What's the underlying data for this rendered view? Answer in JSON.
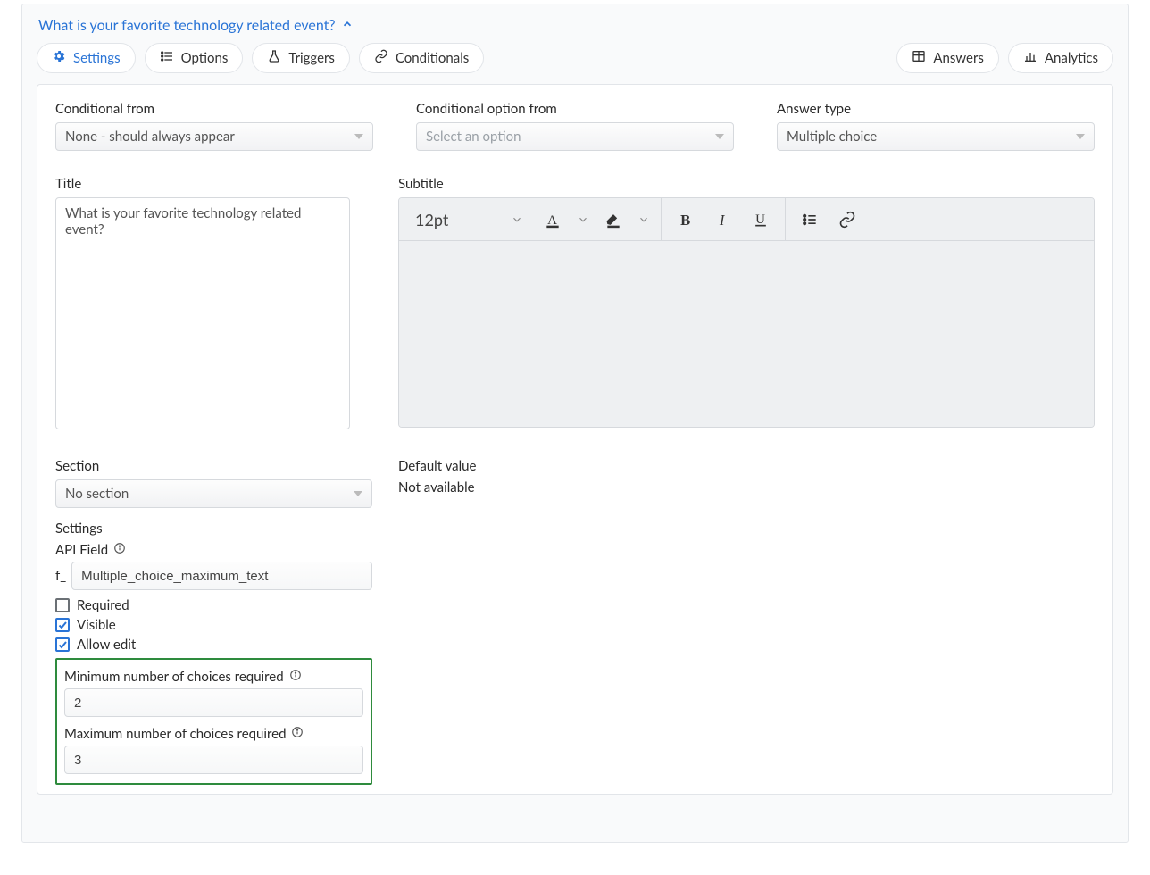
{
  "header": {
    "question_title": "What is your favorite technology related event?",
    "tabs": {
      "settings": "Settings",
      "options": "Options",
      "triggers": "Triggers",
      "conditionals": "Conditionals"
    },
    "right": {
      "answers": "Answers",
      "analytics": "Analytics"
    }
  },
  "fields": {
    "conditional_from": {
      "label": "Conditional from",
      "value": "None - should always appear"
    },
    "conditional_option_from": {
      "label": "Conditional option from",
      "value": "Select an option"
    },
    "answer_type": {
      "label": "Answer type",
      "value": "Multiple choice"
    },
    "title": {
      "label": "Title",
      "value": "What is your favorite technology related event?"
    },
    "subtitle": {
      "label": "Subtitle",
      "font_size": "12pt"
    },
    "section": {
      "label": "Section",
      "value": "No section"
    },
    "default_value": {
      "label": "Default value",
      "text": "Not available"
    },
    "settings_heading": "Settings",
    "api_field": {
      "label": "API Field",
      "prefix": "f_",
      "value": "Multiple_choice_maximum_text"
    },
    "checkboxes": {
      "required": {
        "label": "Required",
        "checked": false
      },
      "visible": {
        "label": "Visible",
        "checked": true
      },
      "allow_edit": {
        "label": "Allow edit",
        "checked": true
      }
    },
    "min_choices": {
      "label": "Minimum number of choices required",
      "value": "2"
    },
    "max_choices": {
      "label": "Maximum number of choices required",
      "value": "3"
    }
  }
}
